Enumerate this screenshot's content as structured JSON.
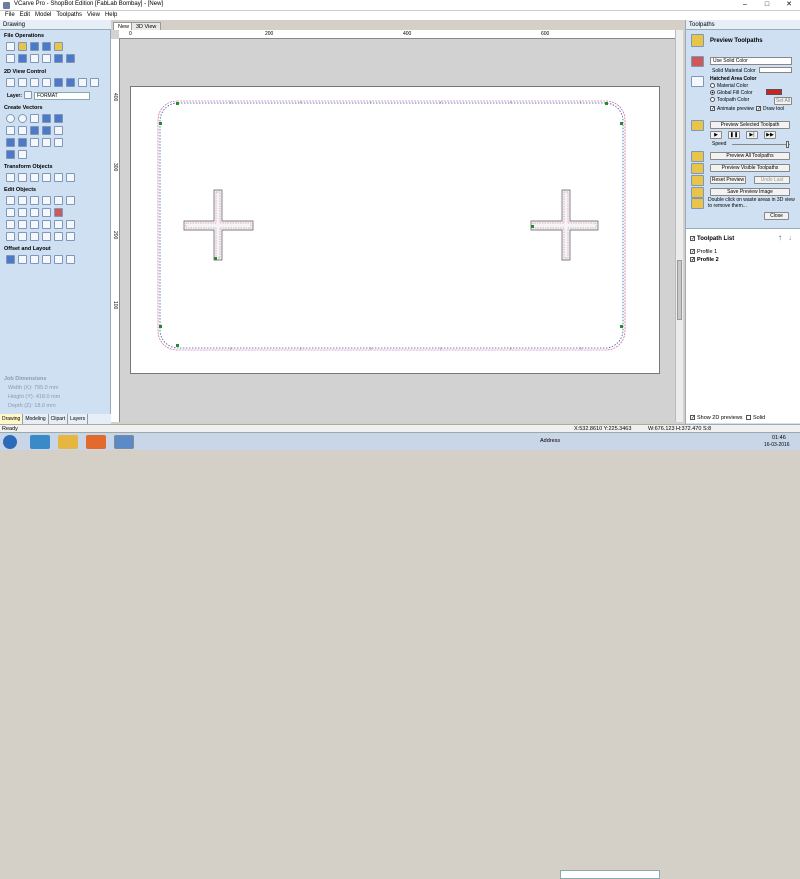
{
  "window": {
    "title": "VCarve Pro - ShopBot Edition [FabLab Bombay] - [New]",
    "min": "–",
    "max": "□",
    "close": "✕"
  },
  "menu": [
    "File",
    "Edit",
    "Model",
    "Toolpaths",
    "View",
    "Help"
  ],
  "left": {
    "header": "Drawing",
    "sections": {
      "file_ops": "File Operations",
      "view_ctrl": "2D View Control",
      "create_vectors": "Create Vectors",
      "transform": "Transform Objects",
      "edit_objects": "Edit Objects",
      "offset_layout": "Offset and Layout"
    },
    "layer_label": "Layer:",
    "layer_value": "FORMAT",
    "job": {
      "title": "Job Dimensions",
      "width": "Width  (X): 795.0 mm",
      "height": "Height (Y): 418.0 mm",
      "depth": "Depth  (Z): 18.0 mm"
    },
    "tabs": [
      "Drawing",
      "Modeling",
      "Clipart",
      "Layers"
    ]
  },
  "view_tabs": [
    "New",
    "3D View"
  ],
  "rulers": {
    "h": [
      "0",
      "200",
      "400",
      "600"
    ],
    "v": [
      "400",
      "300",
      "200",
      "100"
    ]
  },
  "right": {
    "header": "Toolpaths",
    "title": "Preview Toolpaths",
    "color_select": "Use Solid Color",
    "solid_label": "Solid Material Color",
    "hatched_label": "Hatched Area Color",
    "radio1": "Material Color",
    "radio2": "Global Fill Color",
    "radio3": "Toolpath Color",
    "set_all": "Set All",
    "animate": "Animate preview",
    "draw_tool": "Draw tool",
    "btn_preview_selected": "Preview Selected Toolpath",
    "speed": "Speed",
    "btn_preview_all": "Preview All Toolpaths",
    "btn_preview_visible": "Preview Visible Toolpaths",
    "btn_reset": "Reset Preview",
    "btn_undo": "Undo Last",
    "btn_save": "Save Preview Image",
    "hint": "Double click on waste areas in 3D view to remove them...",
    "btn_close": "Close",
    "list_title": "Toolpath List",
    "toolpaths": [
      "Profile 1",
      "Profile 2"
    ],
    "show2d": "Show 2D previews",
    "solid": "Solid"
  },
  "status": {
    "ready": "Ready",
    "coords": "X:532.8610 Y:225.3463",
    "dims": "W:676.123  H:372.470  S:8"
  },
  "taskbar": {
    "address": "Address",
    "time": "01:46",
    "date": "16-03-2016"
  },
  "colors": {
    "panel": "#cfe0f3",
    "toolpath": "#c0408a",
    "node": "#2a8a2a",
    "fill": "#cc2222"
  }
}
